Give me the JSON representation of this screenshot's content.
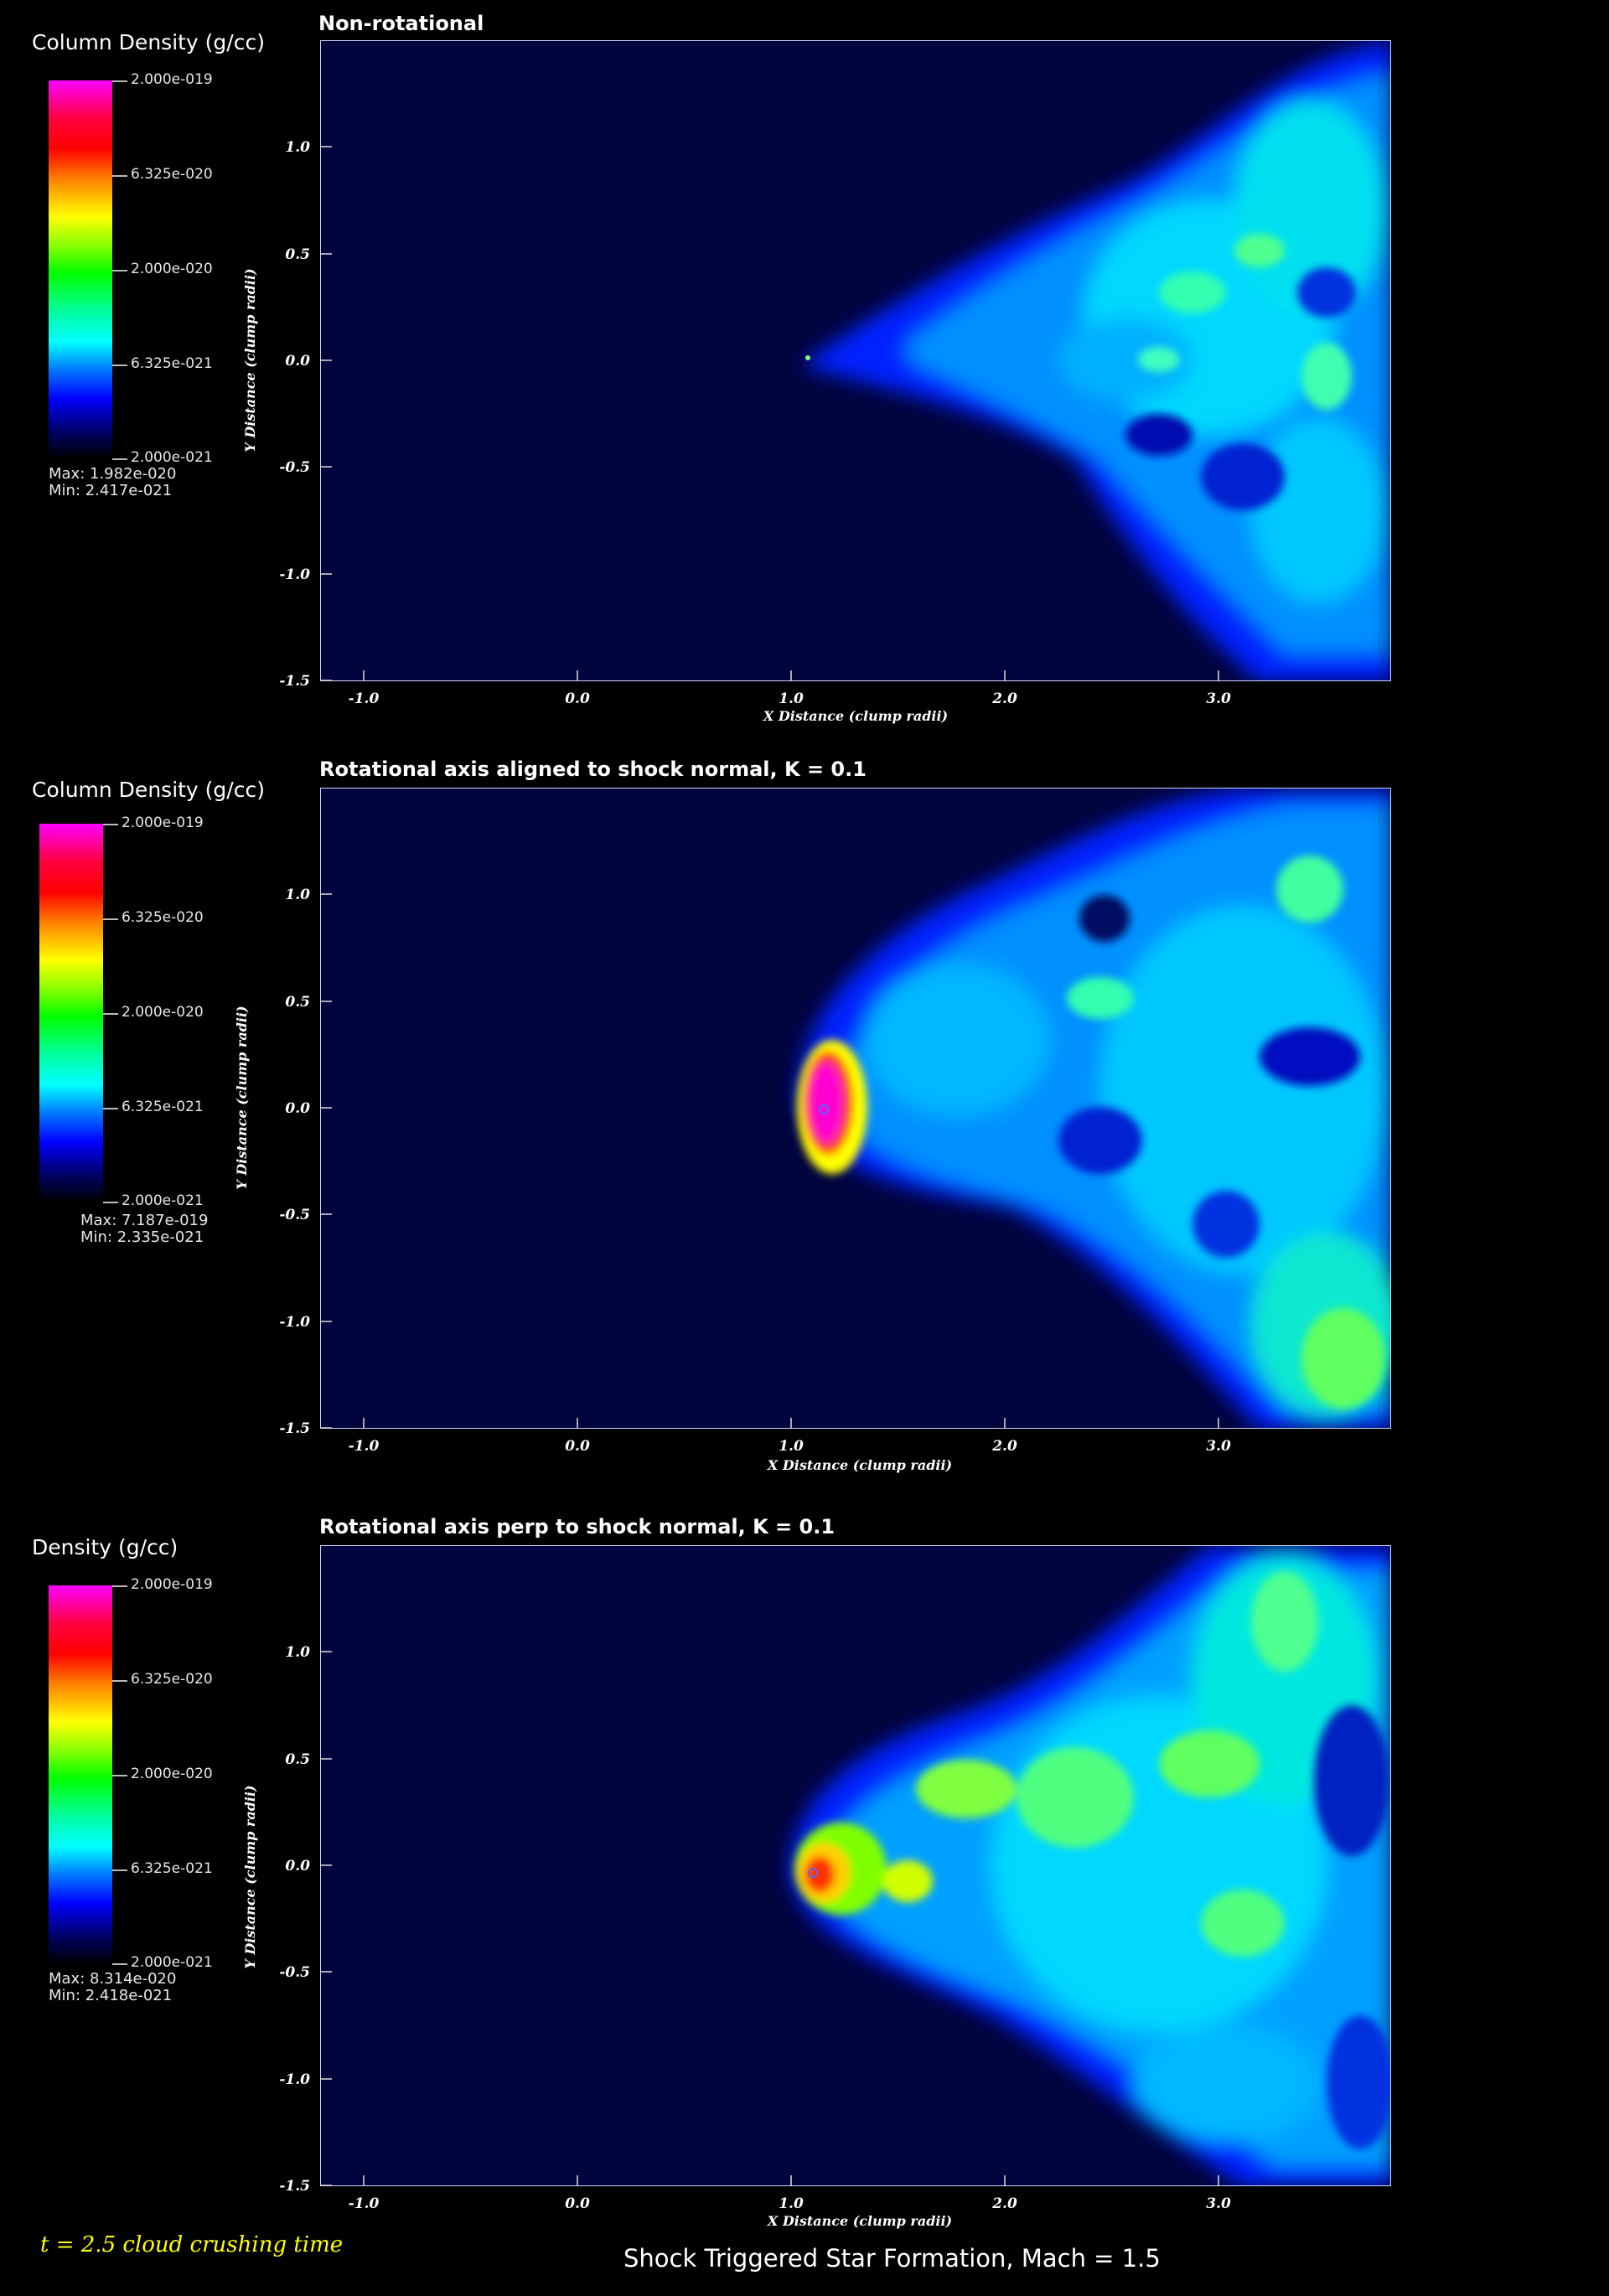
{
  "colorbar_ticks": [
    "2.000e-019",
    "6.325e-020",
    "2.000e-020",
    "6.325e-021",
    "2.000e-021"
  ],
  "x_ticks": [
    "-1.0",
    "0.0",
    "1.0",
    "2.0",
    "3.0"
  ],
  "y_ticks": [
    "1.0",
    "0.5",
    "0.0",
    "-0.5",
    "-1.0",
    "-1.5"
  ],
  "x_axis_label": "X Distance (clump radii)",
  "y_axis_label": "Y Distance (clump radii)",
  "panels": [
    {
      "colorbar_title": "Column Density (g/cc)",
      "title": "Non-rotational",
      "max": "Max: 1.982e-020",
      "min": "Min: 2.417e-021"
    },
    {
      "colorbar_title": "Column Density (g/cc)",
      "title": "Rotational axis aligned to shock normal, K = 0.1",
      "max": "Max: 7.187e-019",
      "min": "Min: 2.335e-021"
    },
    {
      "colorbar_title": "Density (g/cc)",
      "title": "Rotational axis perp to shock normal, K = 0.1",
      "max": "Max: 8.314e-020",
      "min": "Min: 2.418e-021"
    }
  ],
  "footer": {
    "time": "t = 2.5 cloud crushing time",
    "title": "Shock Triggered Star Formation, Mach = 1.5"
  },
  "colors": {
    "background": "#000000",
    "plot_background": "#00043d",
    "colormap": [
      "#ff00ff",
      "#ff0000",
      "#ffff00",
      "#00ff00",
      "#00ffff",
      "#0000ff",
      "#000000"
    ],
    "time_text": "#ffff00"
  }
}
